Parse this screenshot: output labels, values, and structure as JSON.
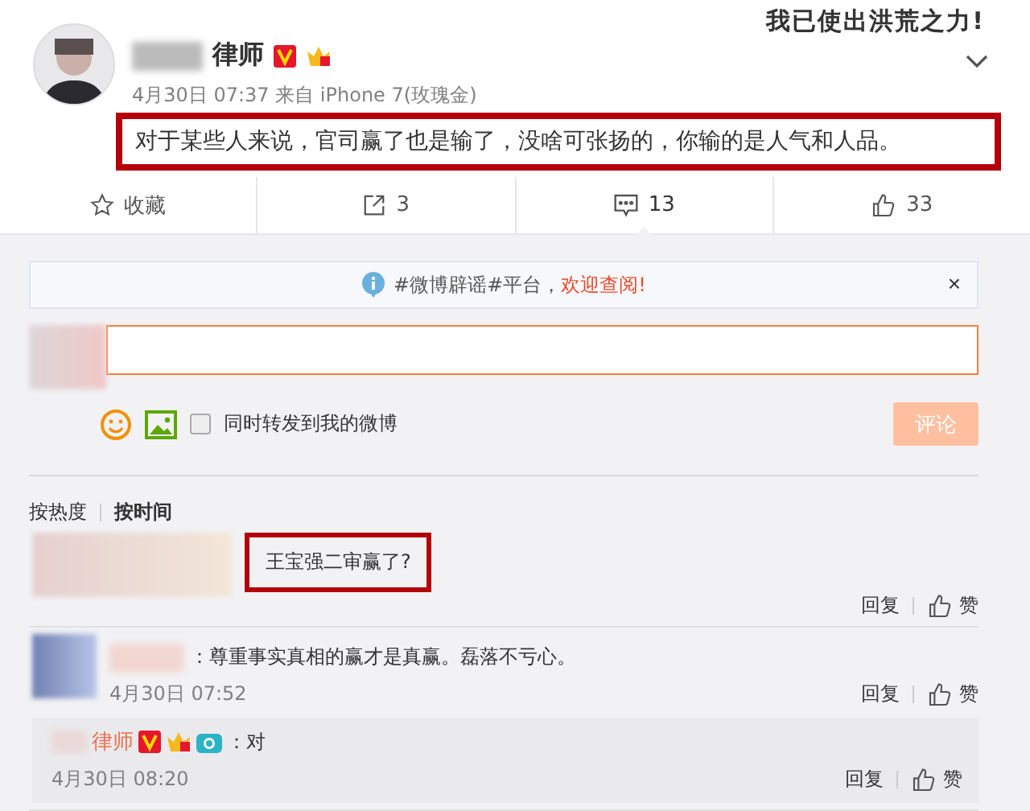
{
  "sticker": "我已使出洪荒之力!",
  "post": {
    "author": "律师",
    "time": "4月30日 07:37 来自 iPhone 7(玫瑰金)",
    "text": "对于某些人来说，官司赢了也是输了，没啥可张扬的，你输的是人气和人品。",
    "highlighted": true
  },
  "actions": [
    {
      "kind": "favorite",
      "label": "收藏",
      "selected": false
    },
    {
      "kind": "repost",
      "label": "3",
      "selected": false
    },
    {
      "kind": "comment",
      "label": "13",
      "selected": true
    },
    {
      "kind": "like",
      "label": "33",
      "selected": false
    }
  ],
  "notice": {
    "text": "#微博辟谣#平台，",
    "link": "欢迎查阅!",
    "close": "×"
  },
  "composer": {
    "repost_label": "同时转发到我的微博",
    "checked": false,
    "submit": "评论"
  },
  "sort": [
    {
      "label": "按热度",
      "selected": false
    },
    {
      "label": "按时间",
      "selected": true
    }
  ],
  "comments": [
    {
      "text": "王宝强二审赢了?",
      "highlighted": true,
      "reply": "回复",
      "like": "赞"
    },
    {
      "text": "：尊重事实真相的赢才是真赢。磊落不亏心。",
      "highlighted": false,
      "time": "4月30日 07:52",
      "reply": "回复",
      "like": "赞",
      "replies": [
        {
          "author": "律师",
          "text": "：对",
          "time": "4月30日 08:20",
          "reply": "回复",
          "like": "赞"
        }
      ]
    }
  ]
}
